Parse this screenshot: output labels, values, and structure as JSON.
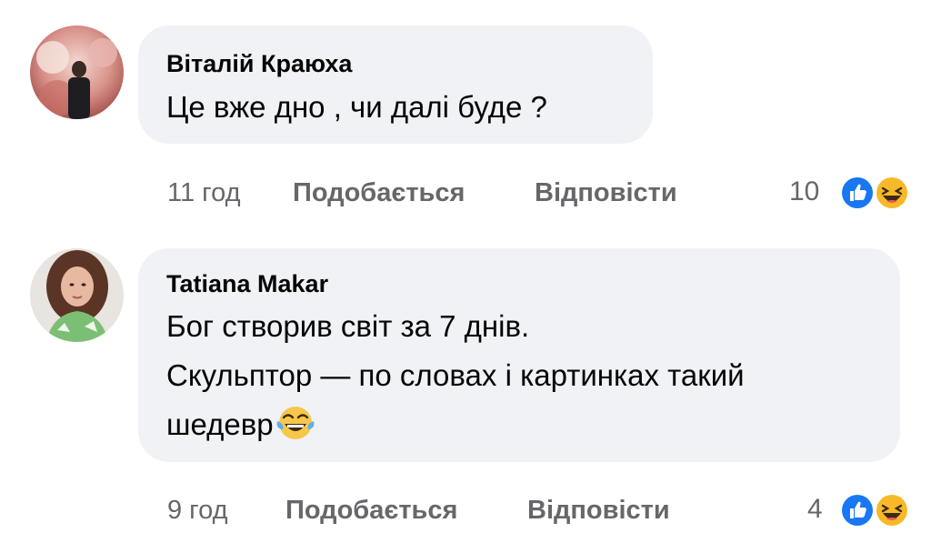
{
  "comments": [
    {
      "author": "Віталій Краюха",
      "lines": [
        "Це вже дно , чи далі буде ?"
      ],
      "time": "11 год",
      "like_label": "Подобається",
      "reply_label": "Відповісти",
      "reaction_count": "10",
      "reactions": [
        "like-icon",
        "haha-icon"
      ],
      "avatar": "profile-photo"
    },
    {
      "author": "Tatiana Makar",
      "lines": [
        "Бог створив світ за 7 днів.",
        "Скульптор — по словах і картинках такий",
        "шедевр"
      ],
      "time": "9 год",
      "like_label": "Подобається",
      "reply_label": "Відповісти",
      "reaction_count": "4",
      "reactions": [
        "like-icon",
        "haha-icon"
      ],
      "avatar": "profile-photo",
      "inline_emoji": "tears-of-joy-emoji"
    }
  ],
  "colors": {
    "bubble": "#f0f2f5",
    "meta_text": "#65676b",
    "like_blue": "#1877f2",
    "haha_yellow": "#f7b928"
  }
}
